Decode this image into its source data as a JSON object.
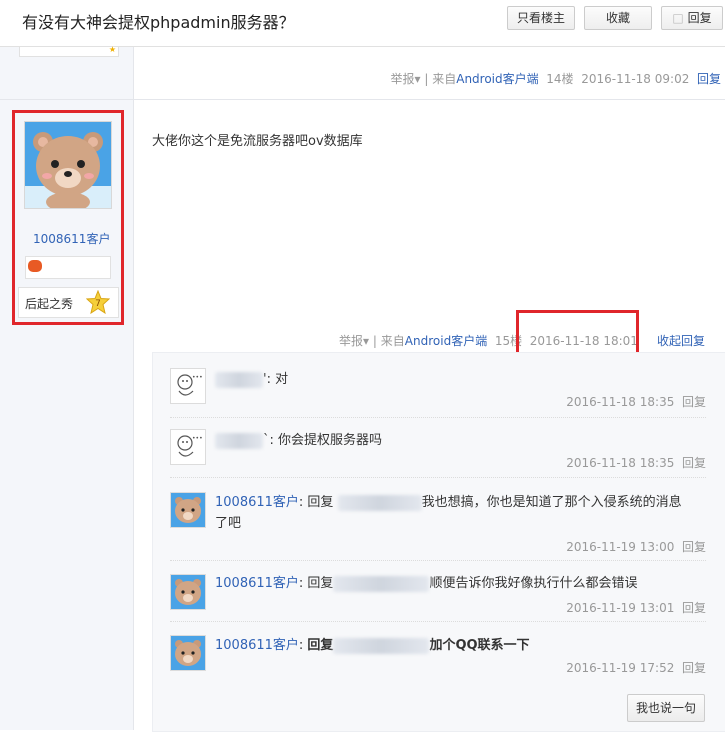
{
  "header": {
    "title": "有没有大神会提权phpadmin服务器？",
    "btn_only_op": "只看楼主",
    "btn_favorite": "收藏",
    "btn_reply": "回复"
  },
  "floor14": {
    "report": "举报",
    "sep": "|",
    "from_prefix": "来自",
    "client": "Android客户端",
    "floor": "14楼",
    "time": "2016-11-18 09:02",
    "reply": "回复"
  },
  "post15": {
    "username": "1008611客户",
    "level_name": "后起之秀",
    "level_num": "7",
    "content": "大佬你这个是免流服务器吧ov数据库",
    "report": "举报",
    "sep": "|",
    "from_prefix": "来自",
    "client": "Android客户端",
    "floor": "15楼",
    "time": "2016-11-18 18:01",
    "collapse_reply": "收起回复"
  },
  "comments": [
    {
      "user": "",
      "text": "对",
      "time": "2016-11-18 18:35",
      "reply": "回复"
    },
    {
      "user": "",
      "text": "你会提权服务器吗",
      "time": "2016-11-18 18:35",
      "reply": "回复"
    },
    {
      "user": "1008611客户",
      "prefix": "回复",
      "text": "我也想搞，你也是知道了那个入侵系统的消息",
      "text2": "了吧",
      "time": "2016-11-19 13:00",
      "reply": "回复"
    },
    {
      "user": "1008611客户",
      "prefix": "回复",
      "text": "顺便告诉你我好像执行什么都会错误",
      "time": "2016-11-19 13:01",
      "reply": "回复"
    },
    {
      "user": "1008611客户",
      "prefix": "回复",
      "text": "加个QQ联系一下",
      "time": "2016-11-19 17:52",
      "reply": "回复"
    }
  ],
  "say_button": "我也说一句",
  "colors": {
    "link": "#3163b6",
    "highlight": "#e0262b",
    "meta": "#999999"
  }
}
